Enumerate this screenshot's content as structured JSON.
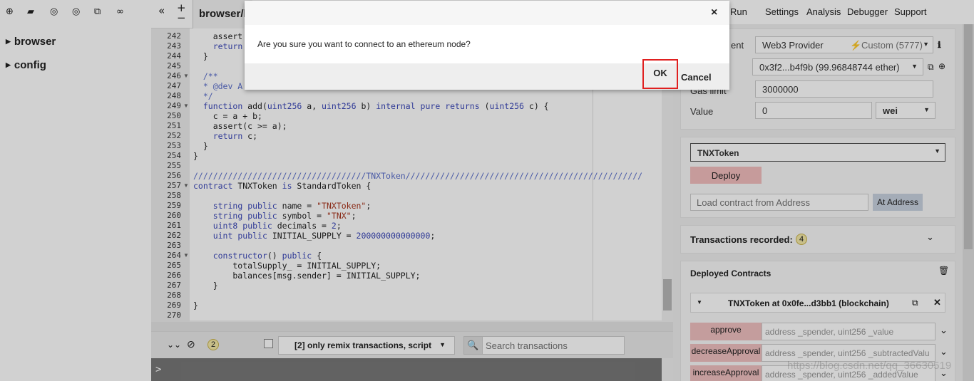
{
  "file_panel": {
    "toolbar_icons": [
      "plus-icon",
      "folder-icon",
      "github-icon",
      "github-icon",
      "copy-icon",
      "link-icon"
    ],
    "tree": [
      {
        "label": "browser"
      },
      {
        "label": "config"
      }
    ]
  },
  "editor": {
    "collapse_label": "«",
    "zoom_label": "+",
    "zoom_out_label": "−",
    "active_tab": "browser/l",
    "lines": [
      {
        "n": "242",
        "text": "    assert"
      },
      {
        "n": "243",
        "text": "    return"
      },
      {
        "n": "244",
        "text": "  }"
      },
      {
        "n": "245",
        "text": ""
      },
      {
        "n": "246",
        "text": "  /**"
      },
      {
        "n": "247",
        "text": "  * @dev A"
      },
      {
        "n": "248",
        "text": "  */"
      },
      {
        "n": "249",
        "text": "  function add(uint256 a, uint256 b) internal pure returns (uint256 c) {"
      },
      {
        "n": "250",
        "text": "    c = a + b;"
      },
      {
        "n": "251",
        "text": "    assert(c >= a);"
      },
      {
        "n": "252",
        "text": "    return c;"
      },
      {
        "n": "253",
        "text": "  }"
      },
      {
        "n": "254",
        "text": "}"
      },
      {
        "n": "255",
        "text": ""
      },
      {
        "n": "256",
        "text": "///////////////////////////////////TNXToken////////////////////////////////////////////////"
      },
      {
        "n": "257",
        "text": "contract TNXToken is StandardToken {"
      },
      {
        "n": "258",
        "text": ""
      },
      {
        "n": "259",
        "text": "    string public name = \"TNXToken\";"
      },
      {
        "n": "260",
        "text": "    string public symbol = \"TNX\";"
      },
      {
        "n": "261",
        "text": "    uint8 public decimals = 2;"
      },
      {
        "n": "262",
        "text": "    uint public INITIAL_SUPPLY = 200000000000000;"
      },
      {
        "n": "263",
        "text": ""
      },
      {
        "n": "264",
        "text": "    constructor() public {"
      },
      {
        "n": "265",
        "text": "        totalSupply_ = INITIAL_SUPPLY;"
      },
      {
        "n": "266",
        "text": "        balances[msg.sender] = INITIAL_SUPPLY;"
      },
      {
        "n": "267",
        "text": "    }"
      },
      {
        "n": "268",
        "text": ""
      },
      {
        "n": "269",
        "text": "}"
      },
      {
        "n": "270",
        "text": ""
      }
    ]
  },
  "terminal": {
    "pending_count": "2",
    "filter_label": "[2] only remix transactions, script",
    "search_placeholder": "Search transactions",
    "prompt": ">"
  },
  "right_panel": {
    "tabs": [
      "Run",
      "Settings",
      "Analysis",
      "Debugger",
      "Support"
    ],
    "environment_label": "ent",
    "environment_value": "Web3 Provider",
    "environment_custom": "Custom (5777)",
    "account_value": "0x3f2...b4f9b (99.96848744 ether)",
    "gas_limit_label": "Gas limit",
    "gas_limit_value": "3000000",
    "value_label": "Value",
    "value_amount": "0",
    "value_unit": "wei",
    "contract_select": "TNXToken",
    "deploy_label": "Deploy",
    "load_placeholder": "Load contract from Address",
    "at_address_label": "At Address",
    "tx_recorded_label": "Transactions recorded:",
    "tx_recorded_count": "4",
    "deployed_label": "Deployed Contracts",
    "instance_label": "TNXToken at 0x0fe...d3bb1 (blockchain)",
    "functions": [
      {
        "name": "approve",
        "params": "address _spender, uint256 _value"
      },
      {
        "name": "decreaseApproval",
        "params": "address _spender, uint256 _subtractedValu"
      },
      {
        "name": "increaseApproval",
        "params": "address _spender, uint256 _addedValue"
      }
    ],
    "watermark": "https://blog.csdn.net/qq_36630519"
  },
  "modal": {
    "close_label": "×",
    "message": "Are you sure you want to connect to an ethereum node?",
    "ok_label": "OK",
    "cancel_label": "Cancel"
  },
  "colors": {
    "accent_red": "#e02020",
    "function_button": "#f0c0c0",
    "deploy_button": "#f2bdbd"
  }
}
